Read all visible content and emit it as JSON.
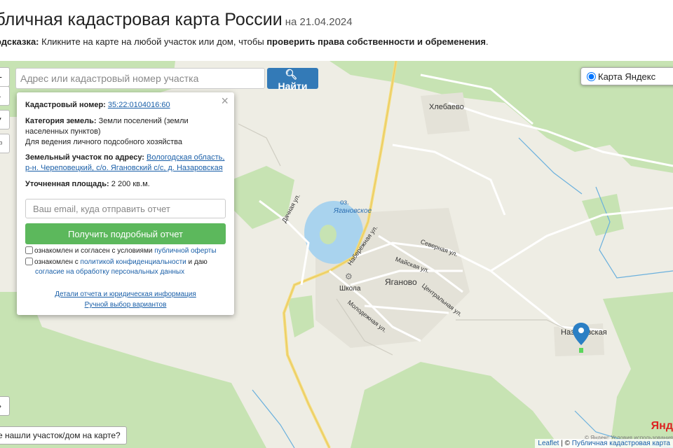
{
  "page": {
    "title": "ібличная кадастровая карта России",
    "date": "на 21.04.2024",
    "hint_prefix": "одсказка:",
    "hint_text": " Кликните на карте на любой участок или дом, чтобы ",
    "hint_bold": "проверить права собственности и обременения",
    "hint_end": "."
  },
  "search": {
    "placeholder": "Адрес или кадастровый номер участка",
    "button": "Найти"
  },
  "layer_switch": {
    "label": "Карта Яндекс"
  },
  "popup": {
    "close": "×",
    "cad_label": "Кадастровый номер:",
    "cad_value": "35:22:0104016:60",
    "category_label": "Категория земель:",
    "category_value": " Земли поселений (земли населенных пунктов)",
    "usage": "Для ведения личного подсобного хозяйства",
    "address_label": "Земельный участок по адресу:",
    "address_value": "Вологодская область, р-н. Череповецкий, с/о. Ягановский с/с, д. Назаровская",
    "area_label": "Уточненная площадь:",
    "area_value": " 2 200 кв.м.",
    "email_placeholder": "Ваш email, куда отправить отчет",
    "report_button": "Получить подробный отчет",
    "check1_text": "ознакомлен и согласен с условиями ",
    "check1_link": "публичной оферты",
    "check2_text": "ознакомлен с ",
    "check2_link": "политикой конфиденциальности",
    "check2_text2": " и даю ",
    "check2_link2": "согласие на обработку персональных данных",
    "details_link": "Детали отчета и юридическая информация",
    "manual_link": "Ручной выбор вариантов"
  },
  "map_labels": {
    "khlebaevo": "Хлебаево",
    "lake_prefix": "оз.",
    "lake_name": "Ягановское",
    "yaganovo": "Яганово",
    "school": "Школа",
    "nazarovskaya": "Назаровская",
    "dachnaya": "Дачная ул.",
    "naberezhnaya": "Набережная ул.",
    "severnaya": "Северная ул.",
    "mayskaya": "Майская ул.",
    "tsentralnaya": "Центральная ул.",
    "molodezhnaya": "Молодежная ул."
  },
  "controls": {
    "zoom_in": "+",
    "zoom_out": "-",
    "not_found": "е нашли участок/дом на карте?"
  },
  "attribution": {
    "leaflet": "Leaflet",
    "sep": " | © ",
    "source": "Публичная кадастровая карта",
    "yandex": "Янд",
    "terms": "© Яндекс Условия использования"
  }
}
